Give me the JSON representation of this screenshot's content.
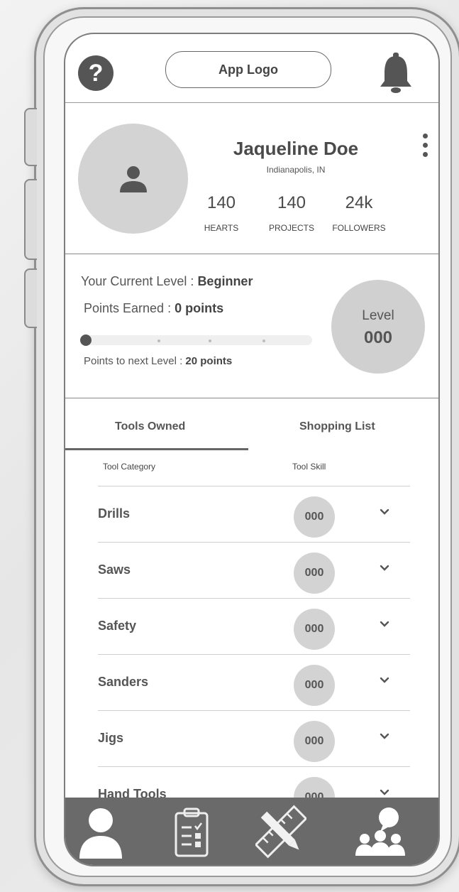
{
  "header": {
    "help_icon": "question-icon",
    "help_glyph": "?",
    "logo_label": "App Logo",
    "bell_icon": "bell-icon"
  },
  "profile": {
    "name": "Jaqueline Doe",
    "location": "Indianapolis, IN",
    "stats": [
      {
        "value": "140",
        "label": "HEARTS"
      },
      {
        "value": "140",
        "label": "PROJECTS"
      },
      {
        "value": "24k",
        "label": "FOLLOWERS"
      }
    ]
  },
  "level": {
    "current_prefix": "Your Current Level : ",
    "current_value": "Beginner",
    "points_prefix": "Points Earned : ",
    "points_value": "0 points",
    "next_prefix": "Points to next Level : ",
    "next_value": "20 points",
    "progress_fraction": 0,
    "badge_label": "Level",
    "badge_value": "000"
  },
  "tabs": [
    {
      "label": "Tools Owned",
      "active": true
    },
    {
      "label": "Shopping List",
      "active": false
    }
  ],
  "columns": {
    "category": "Tool Category",
    "skill": "Tool Skill"
  },
  "tools": [
    {
      "category": "Drills",
      "skill": "000"
    },
    {
      "category": "Saws",
      "skill": "000"
    },
    {
      "category": "Safety",
      "skill": "000"
    },
    {
      "category": "Sanders",
      "skill": "000"
    },
    {
      "category": "Jigs",
      "skill": "000"
    },
    {
      "category": "Hand Tools",
      "skill": "000"
    }
  ],
  "bottom_nav": [
    "profile-icon",
    "checklist-icon",
    "pencil-ruler-icon",
    "community-icon"
  ],
  "colors": {
    "dark": "#555555",
    "nav_bg": "#6a6a6a",
    "circle_fill": "#d3d3d3"
  }
}
